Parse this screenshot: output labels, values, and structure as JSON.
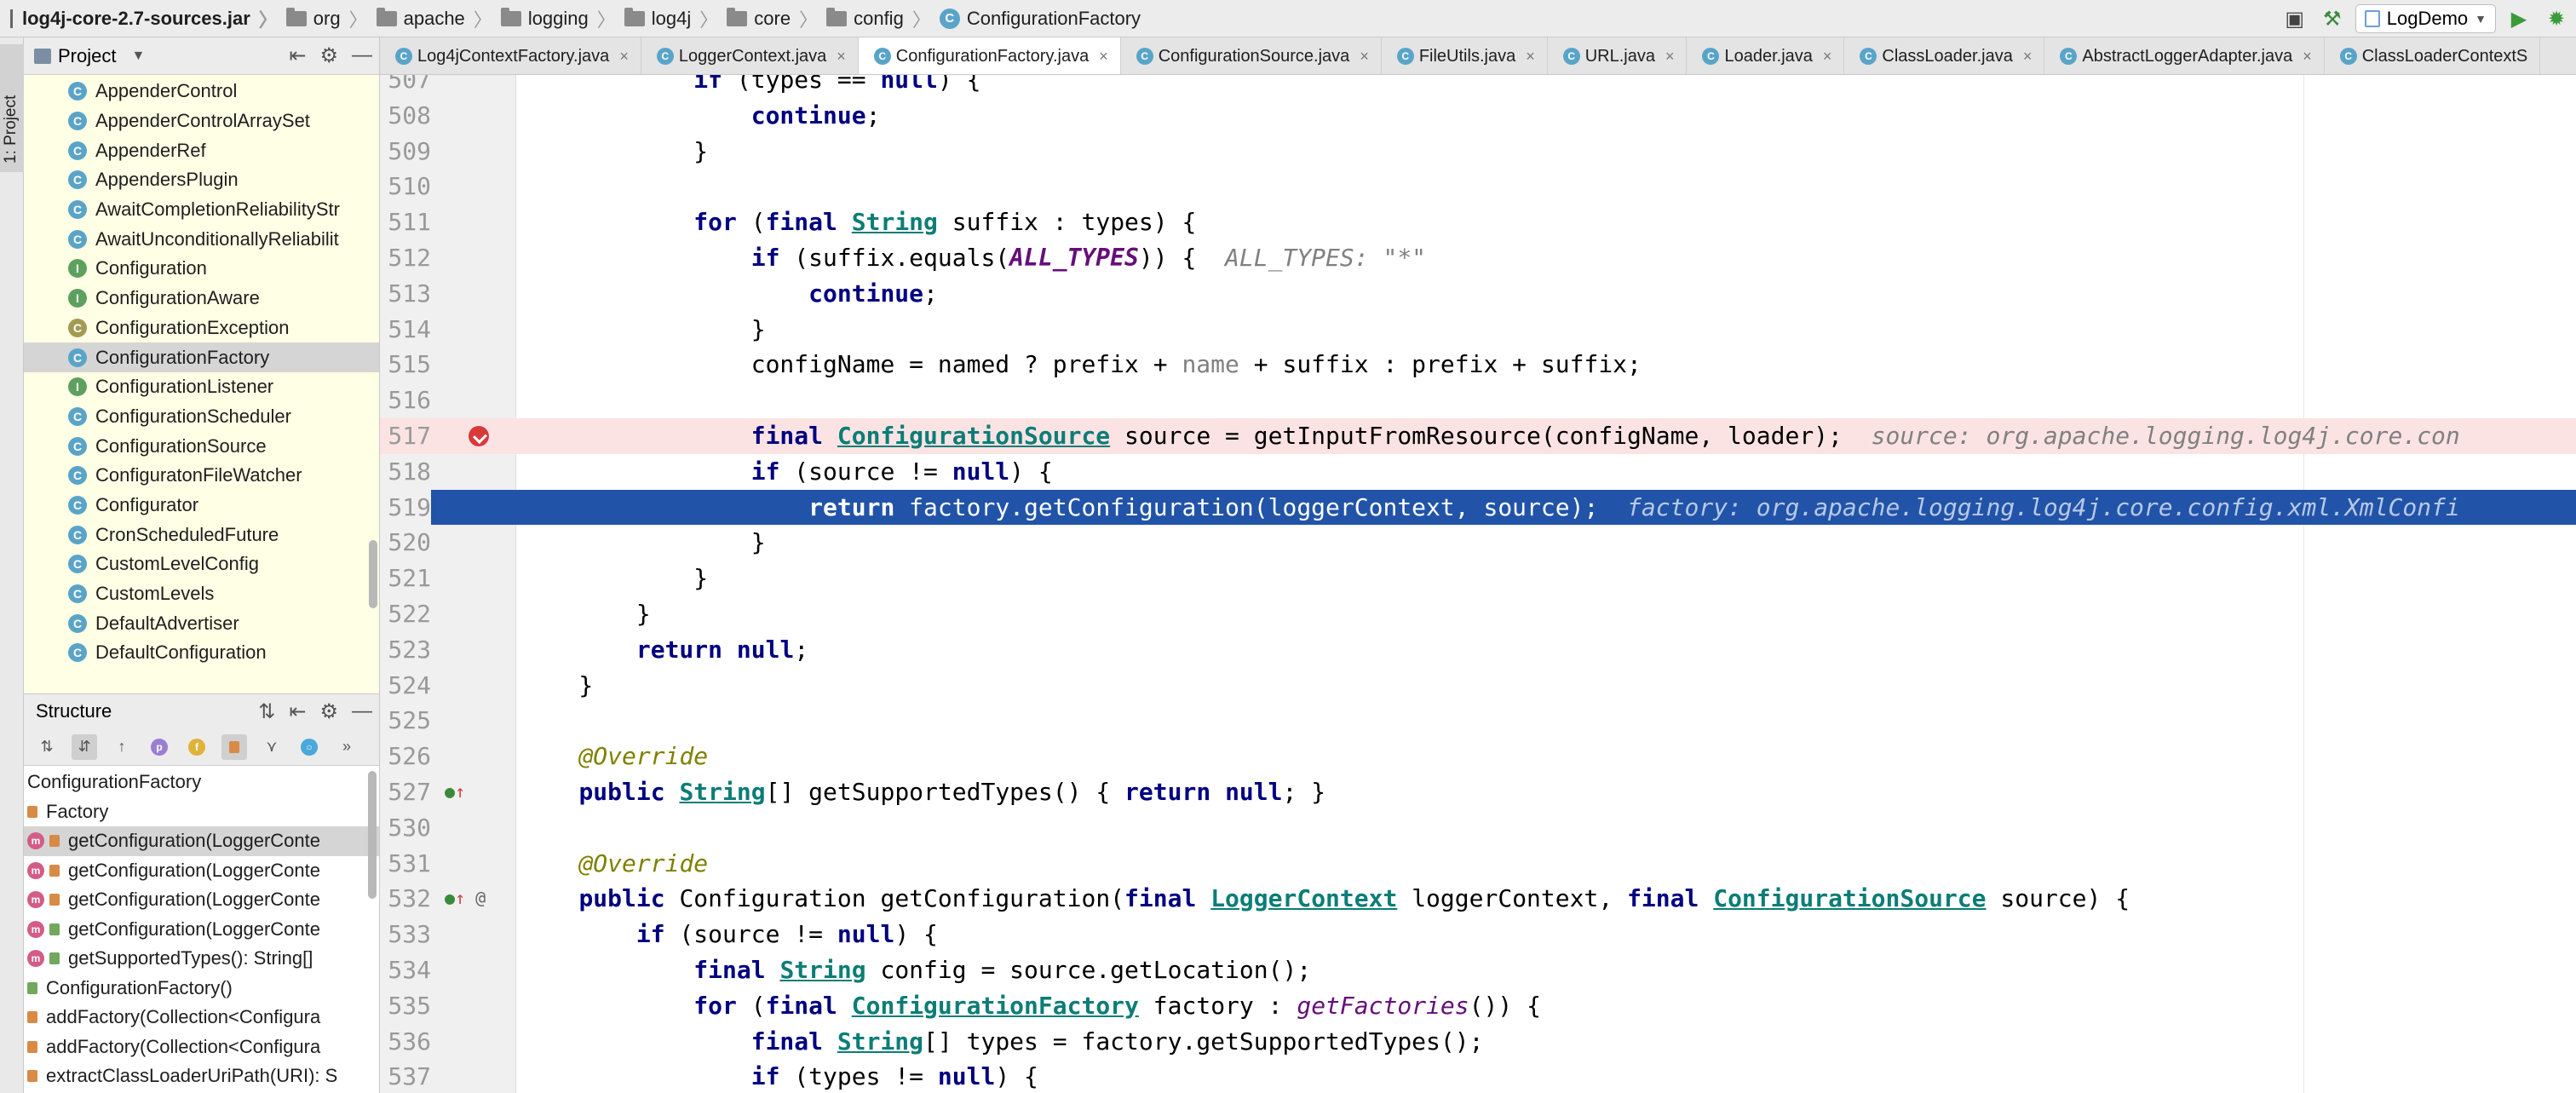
{
  "breadcrumb": [
    {
      "label": "log4j-core-2.7-sources.jar",
      "icon": "jar-icon"
    },
    {
      "label": "org",
      "icon": "folder-icon"
    },
    {
      "label": "apache",
      "icon": "folder-icon"
    },
    {
      "label": "logging",
      "icon": "folder-icon"
    },
    {
      "label": "log4j",
      "icon": "folder-icon"
    },
    {
      "label": "core",
      "icon": "folder-icon"
    },
    {
      "label": "config",
      "icon": "folder-icon"
    },
    {
      "label": "ConfigurationFactory",
      "icon": "class-icon"
    }
  ],
  "run_config": {
    "label": "LogDemo"
  },
  "tool_strip": {
    "project_tab": "1: Project"
  },
  "project_panel": {
    "title": "Project",
    "items": [
      {
        "label": "AppenderControl",
        "kind": "C"
      },
      {
        "label": "AppenderControlArraySet",
        "kind": "C"
      },
      {
        "label": "AppenderRef",
        "kind": "C"
      },
      {
        "label": "AppendersPlugin",
        "kind": "C"
      },
      {
        "label": "AwaitCompletionReliabilityStr",
        "kind": "C"
      },
      {
        "label": "AwaitUnconditionallyReliabilit",
        "kind": "C"
      },
      {
        "label": "Configuration",
        "kind": "I"
      },
      {
        "label": "ConfigurationAware",
        "kind": "I"
      },
      {
        "label": "ConfigurationException",
        "kind": "E"
      },
      {
        "label": "ConfigurationFactory",
        "kind": "C",
        "selected": true
      },
      {
        "label": "ConfigurationListener",
        "kind": "I"
      },
      {
        "label": "ConfigurationScheduler",
        "kind": "C"
      },
      {
        "label": "ConfigurationSource",
        "kind": "C"
      },
      {
        "label": "ConfiguratonFileWatcher",
        "kind": "C"
      },
      {
        "label": "Configurator",
        "kind": "C"
      },
      {
        "label": "CronScheduledFuture",
        "kind": "C"
      },
      {
        "label": "CustomLevelConfig",
        "kind": "C"
      },
      {
        "label": "CustomLevels",
        "kind": "C"
      },
      {
        "label": "DefaultAdvertiser",
        "kind": "C"
      },
      {
        "label": "DefaultConfiguration",
        "kind": "C"
      }
    ]
  },
  "structure_panel": {
    "title": "Structure",
    "items": [
      {
        "label": "ConfigurationFactory",
        "icon": "none"
      },
      {
        "label": "Factory",
        "icon": "lock"
      },
      {
        "label": "getConfiguration(LoggerConte",
        "icon": "m-lock",
        "selected": true
      },
      {
        "label": "getConfiguration(LoggerConte",
        "icon": "m-lock"
      },
      {
        "label": "getConfiguration(LoggerConte",
        "icon": "m-lock"
      },
      {
        "label": "getConfiguration(LoggerConte",
        "icon": "m-public"
      },
      {
        "label": "getSupportedTypes(): String[]",
        "icon": "m-public"
      },
      {
        "label": "ConfigurationFactory()",
        "icon": "public"
      },
      {
        "label": "addFactory(Collection<Configura",
        "icon": "lock"
      },
      {
        "label": "addFactory(Collection<Configura",
        "icon": "lock"
      },
      {
        "label": "extractClassLoaderUriPath(URI): S",
        "icon": "lock"
      }
    ]
  },
  "tabs": [
    {
      "label": "Log4jContextFactory.java"
    },
    {
      "label": "LoggerContext.java"
    },
    {
      "label": "ConfigurationFactory.java",
      "active": true
    },
    {
      "label": "ConfigurationSource.java"
    },
    {
      "label": "FileUtils.java"
    },
    {
      "label": "URL.java"
    },
    {
      "label": "Loader.java"
    },
    {
      "label": "ClassLoader.java"
    },
    {
      "label": "AbstractLoggerAdapter.java"
    },
    {
      "label": "ClassLoaderContextS"
    }
  ],
  "editor": {
    "breakpoint_line": "517",
    "execution_line": "519",
    "lines": [
      {
        "n": "507",
        "text": "            if (types == null) {"
      },
      {
        "n": "508",
        "text": "                continue;"
      },
      {
        "n": "509",
        "text": "            }"
      },
      {
        "n": "510",
        "text": ""
      },
      {
        "n": "511",
        "text": "            for (final String suffix : types) {"
      },
      {
        "n": "512",
        "text": "                if (suffix.equals(ALL_TYPES)) {  ALL_TYPES: \"*\""
      },
      {
        "n": "513",
        "text": "                    continue;"
      },
      {
        "n": "514",
        "text": "                }"
      },
      {
        "n": "515",
        "text": "                configName = named ? prefix + name + suffix : prefix + suffix;"
      },
      {
        "n": "516",
        "text": ""
      },
      {
        "n": "517",
        "text": "                final ConfigurationSource source = getInputFromResource(configName, loader);  source: org.apache.logging.log4j.core.con"
      },
      {
        "n": "518",
        "text": "                if (source != null) {"
      },
      {
        "n": "519",
        "text": "                    return factory.getConfiguration(loggerContext, source);  factory: org.apache.logging.log4j.core.config.xml.XmlConfi"
      },
      {
        "n": "520",
        "text": "                }"
      },
      {
        "n": "521",
        "text": "            }"
      },
      {
        "n": "522",
        "text": "        }"
      },
      {
        "n": "523",
        "text": "        return null;"
      },
      {
        "n": "524",
        "text": "    }"
      },
      {
        "n": "525",
        "text": ""
      },
      {
        "n": "526",
        "text": "    @Override"
      },
      {
        "n": "527",
        "text": "    public String[] getSupportedTypes() { return null; }"
      },
      {
        "n": "530",
        "text": ""
      },
      {
        "n": "531",
        "text": "    @Override"
      },
      {
        "n": "532",
        "text": "    public Configuration getConfiguration(final LoggerContext loggerContext, final ConfigurationSource source) {"
      },
      {
        "n": "533",
        "text": "        if (source != null) {"
      },
      {
        "n": "534",
        "text": "            final String config = source.getLocation();"
      },
      {
        "n": "535",
        "text": "            for (final ConfigurationFactory factory : getFactories()) {"
      },
      {
        "n": "536",
        "text": "                final String[] types = factory.getSupportedTypes();"
      },
      {
        "n": "537",
        "text": "                if (types != null) {"
      }
    ]
  },
  "colors": {
    "execution_highlight": "#2154a8",
    "breakpoint_line": "#fbe3e4",
    "breakpoint": "#d83a3a",
    "project_panel_bg": "#ffffe5",
    "keyword": "#000080",
    "type_link": "#0b7d76",
    "annotation": "#808000"
  }
}
